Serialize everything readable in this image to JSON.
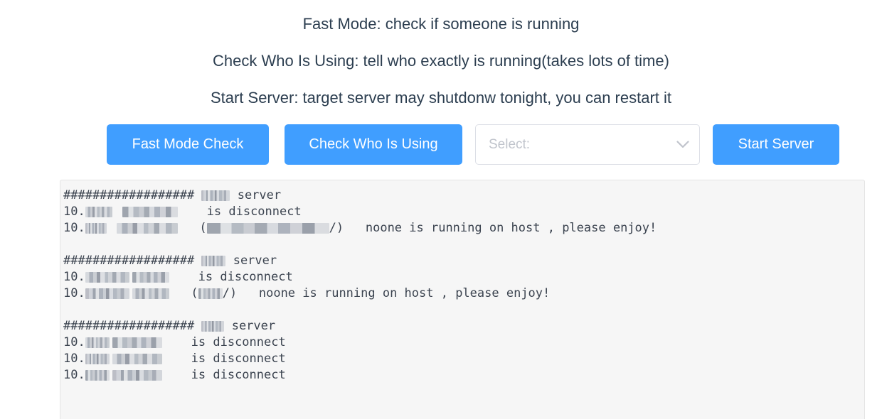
{
  "instructions": [
    "Fast Mode: check if someone is running",
    "Check Who Is Using: tell who exactly is running(takes lots of time)",
    "Start Server: target server may shutdonw tonight, you can restart it"
  ],
  "controls": {
    "fast_mode_button": "Fast Mode Check",
    "check_who_button": "Check Who Is Using",
    "select_placeholder": "Select:",
    "select_value": "",
    "start_server_button": "Start Server",
    "dropdown_icon": "chevron-down-icon",
    "primary_color": "#409eff",
    "border_color": "#dcdfe6",
    "placeholder_color": "#c0c4cc"
  },
  "console": {
    "background_color": "#f6f6f6",
    "text_color": "#3c4450",
    "separator": "##################",
    "blocks": [
      {
        "header_prefix": "##################",
        "header_host_redacted": true,
        "header_suffix": "server",
        "lines": [
          {
            "ip_prefix": "10.",
            "ip_redacted": true,
            "mid_redacted": true,
            "status": "is disconnect",
            "paren": false,
            "message": ""
          },
          {
            "ip_prefix": "10.",
            "ip_redacted": true,
            "mid_redacted": true,
            "status": "",
            "paren": true,
            "message": "noone is running on host , please enjoy!"
          }
        ]
      },
      {
        "header_prefix": "##################",
        "header_host_redacted": true,
        "header_suffix": "server",
        "lines": [
          {
            "ip_prefix": "10.",
            "ip_redacted": true,
            "mid_redacted": false,
            "status": "is disconnect",
            "paren": false,
            "message": ""
          },
          {
            "ip_prefix": "10.",
            "ip_redacted": true,
            "mid_redacted": false,
            "status": "",
            "paren": true,
            "message": "noone is running on host , please enjoy!"
          }
        ]
      },
      {
        "header_prefix": "##################",
        "header_host_redacted": true,
        "header_suffix": "server",
        "lines": [
          {
            "ip_prefix": "10.",
            "ip_redacted": true,
            "mid_redacted": false,
            "status": "is disconnect",
            "paren": false,
            "message": ""
          },
          {
            "ip_prefix": "10.",
            "ip_redacted": true,
            "mid_redacted": false,
            "status": "is disconnect",
            "paren": false,
            "message": ""
          },
          {
            "ip_prefix": "10.",
            "ip_redacted": true,
            "mid_redacted": false,
            "status": "is disconnect",
            "paren": false,
            "message": ""
          }
        ]
      }
    ]
  }
}
